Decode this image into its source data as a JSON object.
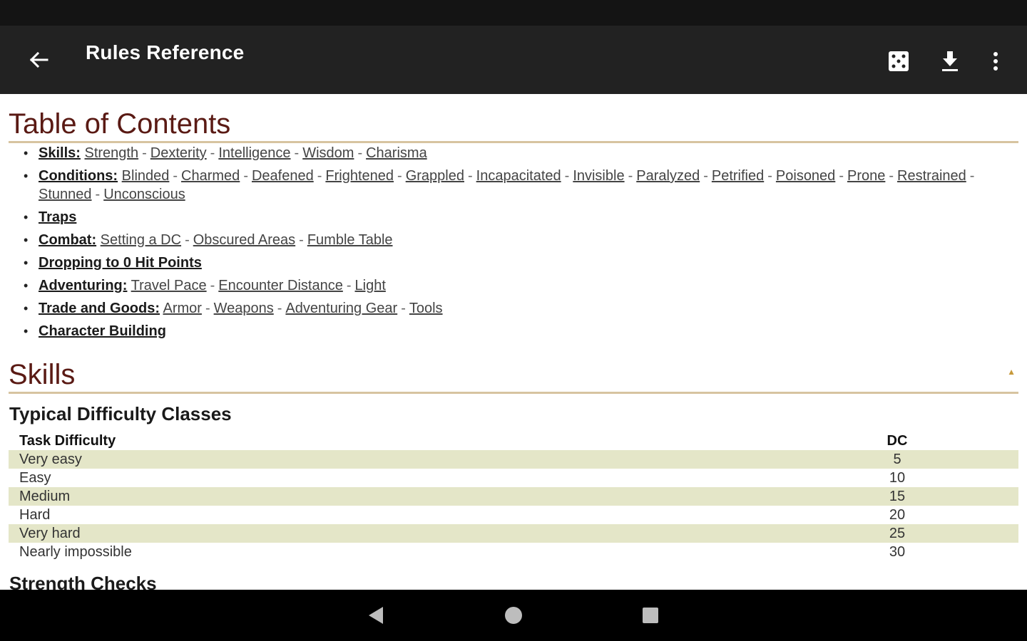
{
  "app_bar": {
    "title": "Rules Reference",
    "icons": [
      "back-arrow-icon",
      "dice-icon",
      "download-icon",
      "more-vert-icon"
    ]
  },
  "toc": {
    "title": "Table of Contents",
    "items": [
      {
        "head": "Skills:",
        "links": [
          "Strength",
          "Dexterity",
          "Intelligence",
          "Wisdom",
          "Charisma"
        ]
      },
      {
        "head": "Conditions:",
        "links": [
          "Blinded",
          "Charmed",
          "Deafened",
          "Frightened",
          "Grappled",
          "Incapacitated",
          "Invisible",
          "Paralyzed",
          "Petrified",
          "Poisoned",
          "Prone",
          "Restrained",
          "Stunned",
          "Unconscious"
        ]
      },
      {
        "head": "Traps",
        "links": []
      },
      {
        "head": "Combat:",
        "links": [
          "Setting a DC",
          "Obscured Areas",
          "Fumble Table"
        ]
      },
      {
        "head": "Dropping to 0 Hit Points",
        "links": []
      },
      {
        "head": "Adventuring:",
        "links": [
          "Travel Pace",
          "Encounter Distance",
          "Light"
        ]
      },
      {
        "head": "Trade and Goods:",
        "links": [
          "Armor",
          "Weapons",
          "Adventuring Gear",
          "Tools"
        ]
      },
      {
        "head": "Character Building",
        "links": []
      }
    ]
  },
  "skills": {
    "title": "Skills",
    "top_arrow": "▲",
    "dc_table": {
      "title": "Typical Difficulty Classes",
      "headers": [
        "Task Difficulty",
        "DC"
      ],
      "rows": [
        [
          "Very easy",
          "5"
        ],
        [
          "Easy",
          "10"
        ],
        [
          "Medium",
          "15"
        ],
        [
          "Hard",
          "20"
        ],
        [
          "Very hard",
          "25"
        ],
        [
          "Nearly impossible",
          "30"
        ]
      ]
    },
    "next_heading": "Strength Checks"
  },
  "colors": {
    "app_bar": "#222222",
    "section_title": "#5a1a14",
    "section_rule": "#d7c4a0",
    "table_stripe": "#e4e6c8"
  },
  "nav_bar": {
    "icons": [
      "back-triangle-icon",
      "home-circle-icon",
      "recents-square-icon"
    ]
  }
}
